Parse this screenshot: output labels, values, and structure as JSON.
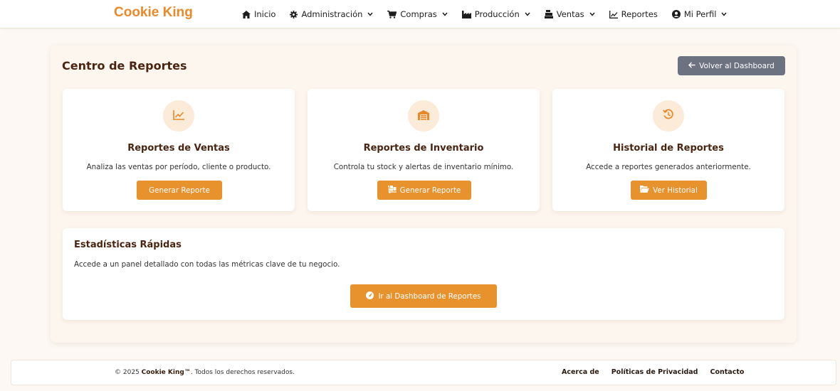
{
  "navbar": {
    "brand": "Cookie King",
    "items": [
      {
        "label": "Inicio",
        "icon": "home-icon",
        "dropdown": false
      },
      {
        "label": "Administración",
        "icon": "gear-icon",
        "dropdown": true
      },
      {
        "label": "Compras",
        "icon": "cart-icon",
        "dropdown": true
      },
      {
        "label": "Producción",
        "icon": "industry-icon",
        "dropdown": true
      },
      {
        "label": "Ventas",
        "icon": "cash-register-icon",
        "dropdown": true
      },
      {
        "label": "Reportes",
        "icon": "line-chart-icon",
        "dropdown": false
      },
      {
        "label": "Mi Perfil",
        "icon": "user-circle-icon",
        "dropdown": true
      }
    ]
  },
  "page": {
    "title": "Centro de Reportes",
    "back_button": "Volver al Dashboard"
  },
  "cards": [
    {
      "title": "Reportes de Ventas",
      "description": "Analiza las ventas por período, cliente o producto.",
      "button": "Generar Reporte",
      "icon": "line-chart-icon"
    },
    {
      "title": "Reportes de Inventario",
      "description": "Controla tu stock y alertas de inventario mínimo.",
      "button": "Generar Reporte",
      "icon": "warehouse-icon"
    },
    {
      "title": "Historial de Reportes",
      "description": "Accede a reportes generados anteriormente.",
      "button": "Ver Historial",
      "icon": "history-icon"
    }
  ],
  "stats": {
    "title": "Estadísticas Rápidas",
    "description": "Accede a un panel detallado con todas las métricas clave de tu negocio.",
    "button": "Ir al Dashboard de Reportes"
  },
  "footer": {
    "copyright_prefix": "© 2025 ",
    "copyright_brand": "Cookie King™",
    "copyright_suffix": ". Todos los derechos reservados.",
    "links": [
      "Acerca de",
      "Políticas de Privacidad",
      "Contacto"
    ]
  },
  "colors": {
    "brand": "#e8892a",
    "accent_button": "#e8922e",
    "secondary_button": "#6c7280",
    "heading": "#4a2410",
    "icon_circle_bg": "#fcebd9"
  }
}
